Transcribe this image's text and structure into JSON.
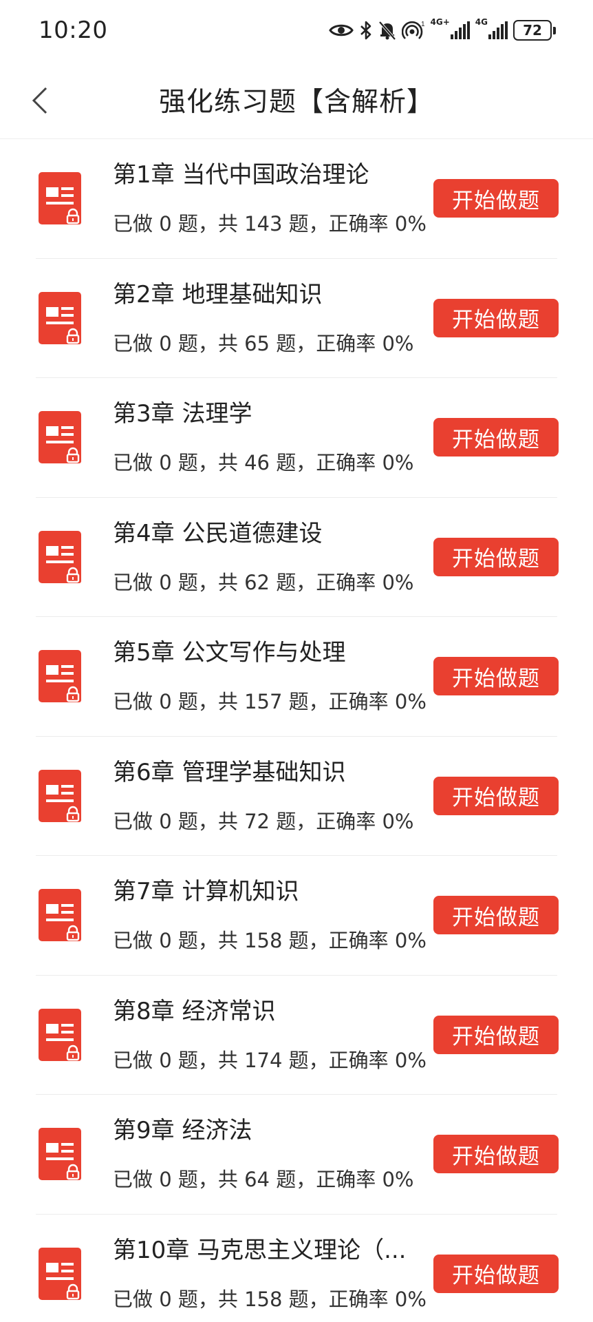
{
  "status_bar": {
    "time": "10:20",
    "net_label_1": "4G+",
    "net_label_2": "4G",
    "battery": "72",
    "icons": [
      "eye-icon",
      "bluetooth-icon",
      "bell-off-icon",
      "hotspot-icon",
      "signal-icon",
      "signal-icon",
      "battery-icon"
    ]
  },
  "header": {
    "title": "强化练习题【含解析】",
    "back_icon": "chevron-left-icon"
  },
  "colors": {
    "accent": "#e94030",
    "text": "#222222",
    "divider": "#ececec"
  },
  "chapters": [
    {
      "title": "第1章 当代中国政治理论",
      "stats": "已做 0 题，共 143 题，正确率 0%",
      "button": "开始做题",
      "icon": "document-lock-icon"
    },
    {
      "title": "第2章 地理基础知识",
      "stats": "已做 0 题，共 65 题，正确率 0%",
      "button": "开始做题",
      "icon": "document-lock-icon"
    },
    {
      "title": "第3章 法理学",
      "stats": "已做 0 题，共 46 题，正确率 0%",
      "button": "开始做题",
      "icon": "document-lock-icon"
    },
    {
      "title": "第4章 公民道德建设",
      "stats": "已做 0 题，共 62 题，正确率 0%",
      "button": "开始做题",
      "icon": "document-lock-icon"
    },
    {
      "title": "第5章 公文写作与处理",
      "stats": "已做 0 题，共 157 题，正确率 0%",
      "button": "开始做题",
      "icon": "document-lock-icon"
    },
    {
      "title": "第6章 管理学基础知识",
      "stats": "已做 0 题，共 72 题，正确率 0%",
      "button": "开始做题",
      "icon": "document-lock-icon"
    },
    {
      "title": "第7章 计算机知识",
      "stats": "已做 0 题，共 158 题，正确率 0%",
      "button": "开始做题",
      "icon": "document-lock-icon"
    },
    {
      "title": "第8章 经济常识",
      "stats": "已做 0 题，共 174 题，正确率 0%",
      "button": "开始做题",
      "icon": "document-lock-icon"
    },
    {
      "title": "第9章 经济法",
      "stats": "已做 0 题，共 64 题，正确率 0%",
      "button": "开始做题",
      "icon": "document-lock-icon"
    },
    {
      "title": "第10章 马克思主义理论（...",
      "stats": "已做 0 题，共 158 题，正确率 0%",
      "button": "开始做题",
      "icon": "document-lock-icon"
    }
  ]
}
